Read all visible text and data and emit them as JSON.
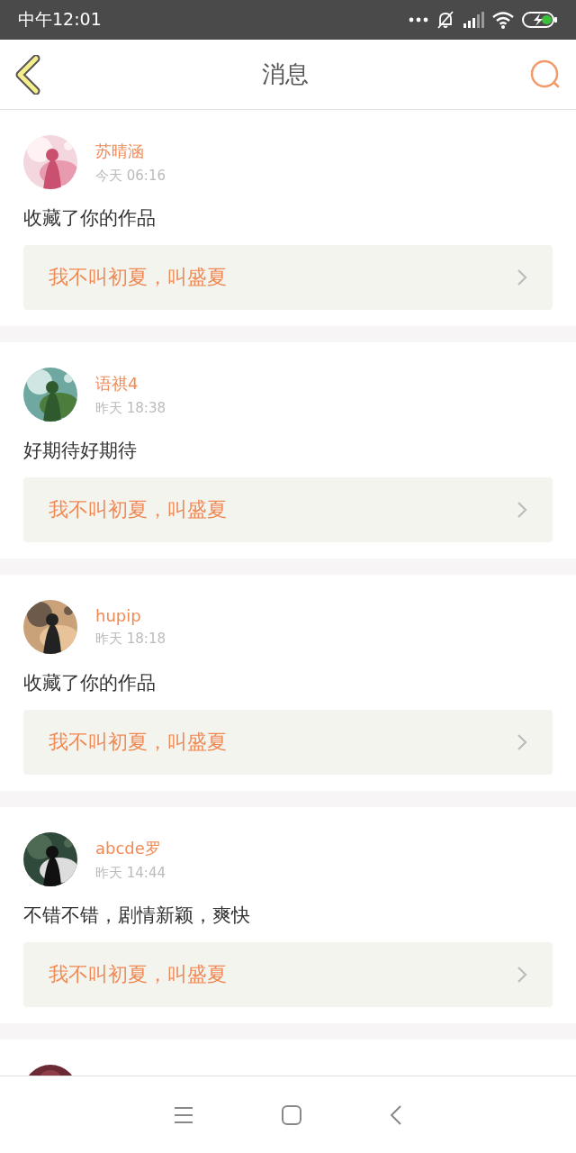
{
  "status_bar": {
    "time": "中午12:01"
  },
  "header": {
    "title": "消息"
  },
  "messages": [
    {
      "name": "苏晴涵",
      "time": "今天 06:16",
      "text": "收藏了你的作品",
      "work_title": "我不叫初夏，叫盛夏"
    },
    {
      "name": "语祺4",
      "time": "昨天 18:38",
      "text": "好期待好期待",
      "work_title": "我不叫初夏，叫盛夏"
    },
    {
      "name": "hupip",
      "time": "昨天 18:18",
      "text": "收藏了你的作品",
      "work_title": "我不叫初夏，叫盛夏"
    },
    {
      "name": "abcde罗",
      "time": "昨天 14:44",
      "text": "不错不错，剧情新颖，爽快",
      "work_title": "我不叫初夏，叫盛夏"
    }
  ]
}
